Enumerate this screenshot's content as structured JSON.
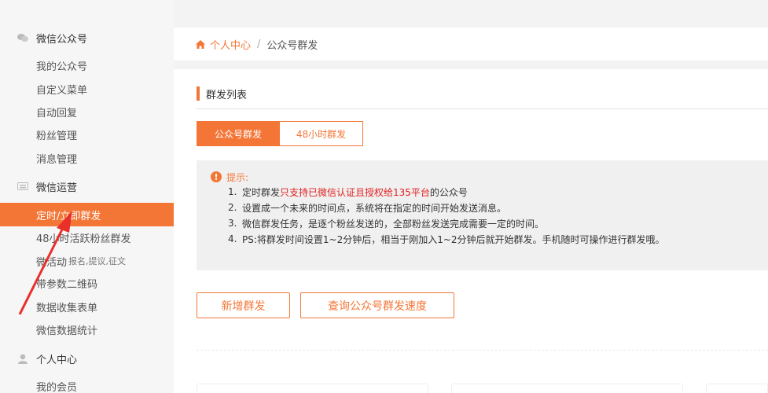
{
  "sidebar": {
    "groups": [
      {
        "title": "微信公众号",
        "icon": "wechat-icon",
        "items": [
          "我的公众号",
          "自定义菜单",
          "自动回复",
          "粉丝管理",
          "消息管理"
        ]
      },
      {
        "title": "微信运营",
        "icon": "keyboard-icon",
        "items": [
          "定时/立即群发",
          "48小时活跃粉丝群发",
          "微活动",
          "带参数二维码",
          "数据收集表单",
          "微信数据统计"
        ]
      },
      {
        "title": "个人中心",
        "icon": "user-icon",
        "items": [
          "我的会员"
        ]
      }
    ],
    "wei_huodong_sub": "报名,提议,征文",
    "active_item": "定时/立即群发"
  },
  "breadcrumb": {
    "home": "个人中心",
    "separator": "/",
    "current": "公众号群发"
  },
  "section": {
    "title": "群发列表"
  },
  "tabs": [
    {
      "label": "公众号群发",
      "active": true
    },
    {
      "label": "48小时群发",
      "active": false
    }
  ],
  "tips": {
    "heading": "提示:",
    "lines": [
      {
        "num": "1.",
        "pre": "定时群发",
        "highlight": "只支持已微信认证且授权给135平台",
        "post": "的公众号"
      },
      {
        "num": "2.",
        "text": "设置成一个未来的时间点，系统将在指定的时间开始发送消息。"
      },
      {
        "num": "3.",
        "text": "微信群发任务，是逐个粉丝发送的，全部粉丝发送完成需要一定的时间。"
      },
      {
        "num": "4.",
        "text": "PS:将群发时间设置1~2分钟后，相当于刚加入1~2分钟后就开始群发。手机随时可操作进行群发哦。"
      }
    ]
  },
  "buttons": {
    "add": "新增群发",
    "query": "查询公众号群发速度"
  },
  "colors": {
    "accent": "#f47637",
    "highlight": "#e02020",
    "annotation": "#e8302a"
  }
}
